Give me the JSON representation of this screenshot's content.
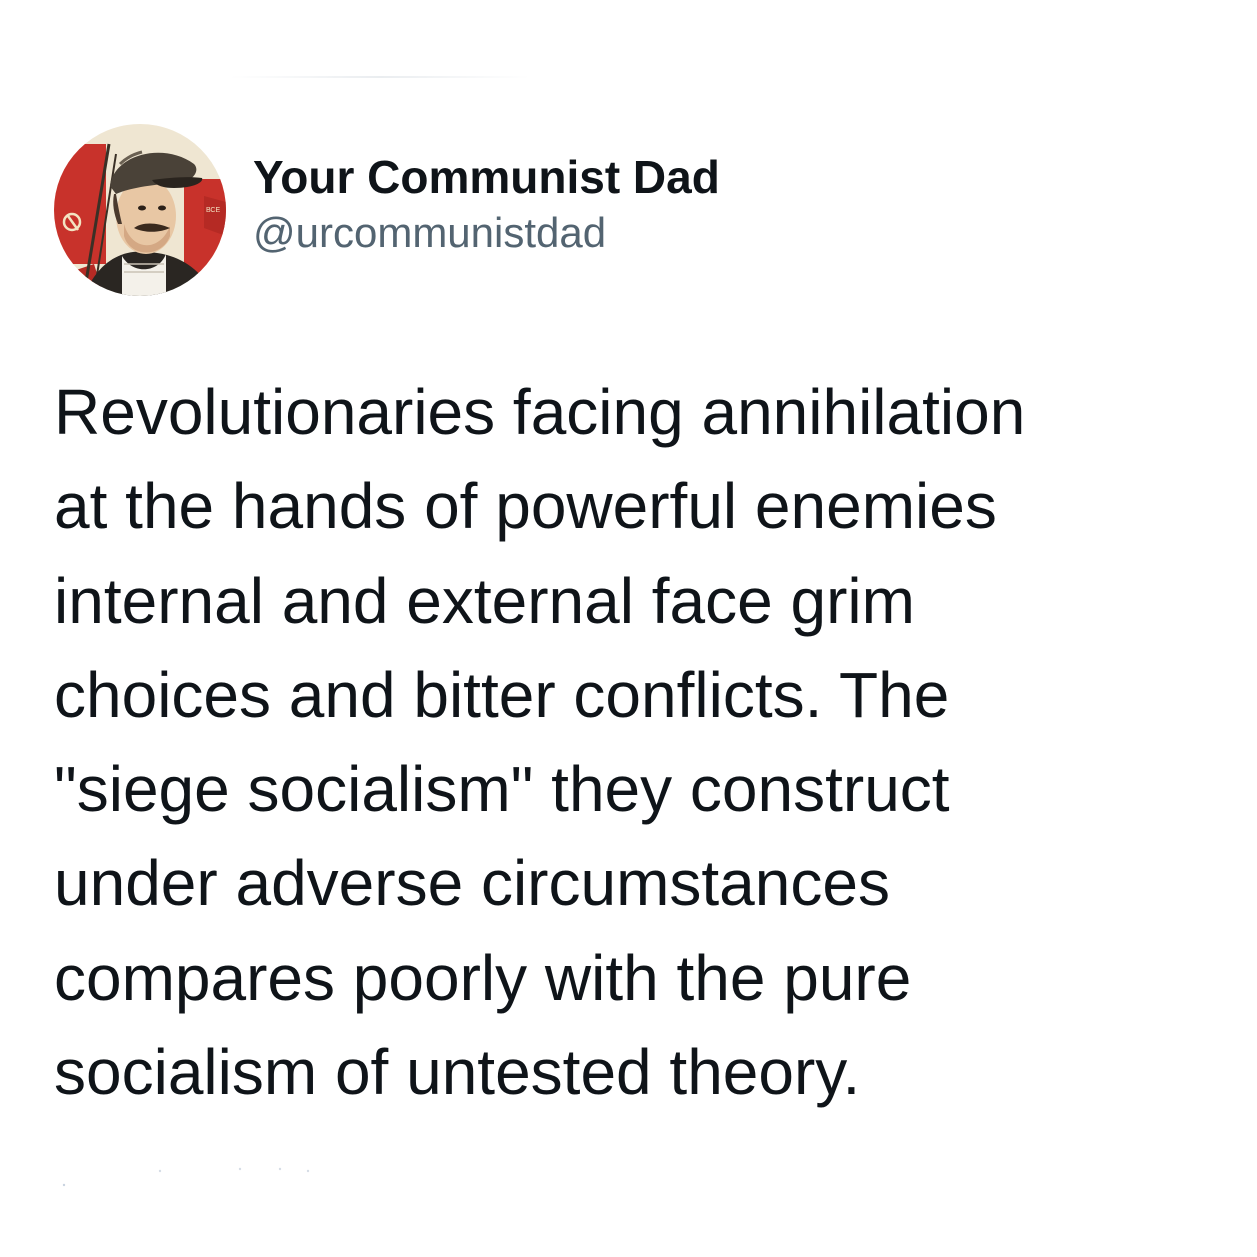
{
  "tweet": {
    "author": {
      "display_name": "Your Communist Dad",
      "handle": "@urcommunistdad",
      "avatar_icon": "soviet-poster-portrait"
    },
    "text_lines": [
      "Revolutionaries facing annihilation",
      "at the hands of powerful enemies",
      "internal and external face grim",
      "choices and bitter conflicts. The",
      "\"siege socialism\" they construct",
      "under adverse circumstances",
      "compares poorly with the pure",
      "socialism of untested theory."
    ]
  },
  "colors": {
    "background": "#ffffff",
    "text_primary": "#0f1419",
    "text_secondary": "#536471",
    "avatar_red": "#c8322b",
    "avatar_cream": "#efe6d2"
  }
}
